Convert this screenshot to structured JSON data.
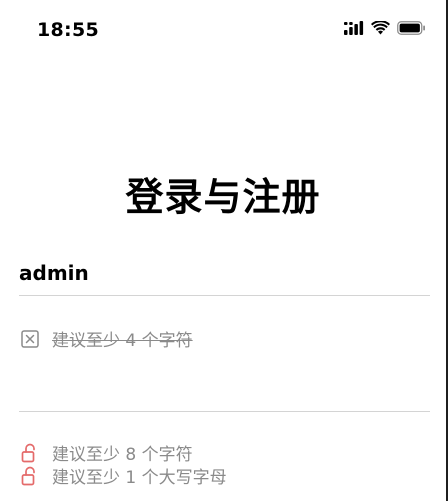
{
  "status_bar": {
    "time": "18:55",
    "icons": [
      "cellular-signal-icon",
      "wifi-icon",
      "battery-icon"
    ]
  },
  "title": "登录与注册",
  "username": {
    "value": "admin",
    "hint": "建议至少 4 个字符",
    "hint_icon": "checkbox-x-icon",
    "hint_satisfied": true
  },
  "password": {
    "value": "",
    "hints": [
      {
        "text": "建议至少 8 个字符",
        "icon": "unlock-icon",
        "color": "#e46a6a"
      },
      {
        "text": "建议至少 1 个大写字母",
        "icon": "unlock-icon",
        "color": "#e46a6a"
      }
    ]
  },
  "colors": {
    "hint_text": "#8a8a8a",
    "warning": "#e46a6a",
    "divider": "#d4d4d4"
  }
}
